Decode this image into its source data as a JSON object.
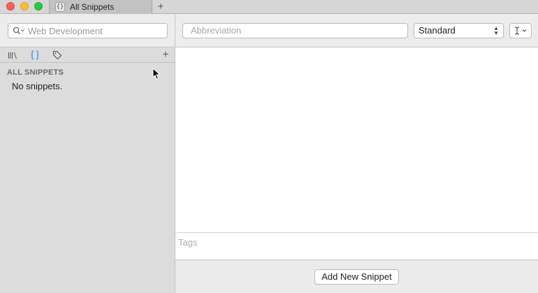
{
  "window": {
    "tab_label": "All Snippets",
    "tab_icon_glyph": "{}",
    "new_tab_glyph": "+"
  },
  "toolbar": {
    "search_placeholder": "Web Development",
    "abbreviation_placeholder": "Abbreviation",
    "expansion_mode": "Standard",
    "cursor_icon": "text-cursor-icon"
  },
  "sidebar": {
    "tabs": [
      {
        "name": "library-icon"
      },
      {
        "name": "snippets-icon",
        "active": true
      },
      {
        "name": "tag-icon"
      }
    ],
    "add_glyph": "+",
    "heading": "ALL SNIPPETS",
    "empty_text": "No snippets."
  },
  "editor": {
    "tags_placeholder": "Tags"
  },
  "footer": {
    "add_button_label": "Add New Snippet"
  },
  "colors": {
    "accent": "#1a82fb",
    "close": "#fc5f57",
    "minimize": "#fdbc2e",
    "zoom": "#28c840"
  }
}
